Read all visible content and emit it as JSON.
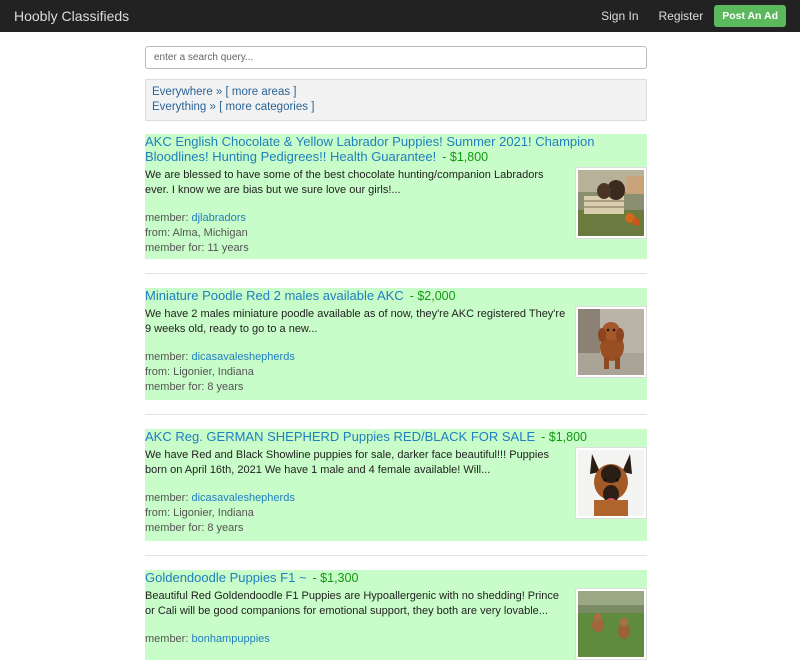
{
  "nav": {
    "brand": "Hoobly Classifieds",
    "sign_in": "Sign In",
    "register": "Register",
    "post_ad": "Post An Ad"
  },
  "search": {
    "placeholder": "enter a search query..."
  },
  "filters": {
    "location": "Everywhere",
    "location_more": "[ more areas ]",
    "category": "Everything",
    "category_more": "[ more categories ]",
    "separator": "»"
  },
  "listings": [
    {
      "title": "AKC English Chocolate & Yellow Labrador Puppies! Summer 2021! Champion Bloodlines! Hunting Pedigrees!! Health Guarantee!",
      "price": "- $1,800",
      "description": "We are blessed to have some of the best chocolate hunting/companion Labradors ever. I know we are bias but we sure love our girls!...",
      "member_label": "member:",
      "member": "djlabradors",
      "from": "from: Alma, Michigan",
      "member_for": "member for: 11 years"
    },
    {
      "title": "Miniature Poodle Red 2 males available AKC",
      "price": "- $2,000",
      "description": "We have 2 males miniature poodle available as of now, they're AKC registered They're 9 weeks old, ready to go to a new...",
      "member_label": "member:",
      "member": "dicasavaleshepherds",
      "from": "from: Ligonier, Indiana",
      "member_for": "member for: 8 years"
    },
    {
      "title": "AKC Reg. GERMAN SHEPHERD Puppies RED/BLACK FOR SALE",
      "price": "- $1,800",
      "description": "We have Red and Black Showline puppies for sale, darker face beautiful!!! Puppies born on April 16th, 2021 We have 1 male and 4 female available! Will...",
      "member_label": "member:",
      "member": "dicasavaleshepherds",
      "from": "from: Ligonier, Indiana",
      "member_for": "member for: 8 years"
    },
    {
      "title": "Goldendoodle Puppies F1 ~",
      "price": "- $1,300",
      "description": "Beautiful Red Goldendoodle F1 Puppies are Hypoallergenic with no shedding! Prince or Cali will be good companions for emotional support, they both are very lovable...",
      "member_label": "member:",
      "member": "bonhampuppies"
    }
  ],
  "colors": {
    "navbar": "#222222",
    "post_button": "#5cb85c",
    "listing_highlight": "#c8fcc8",
    "price": "#119911",
    "link": "#1f7fbf"
  }
}
